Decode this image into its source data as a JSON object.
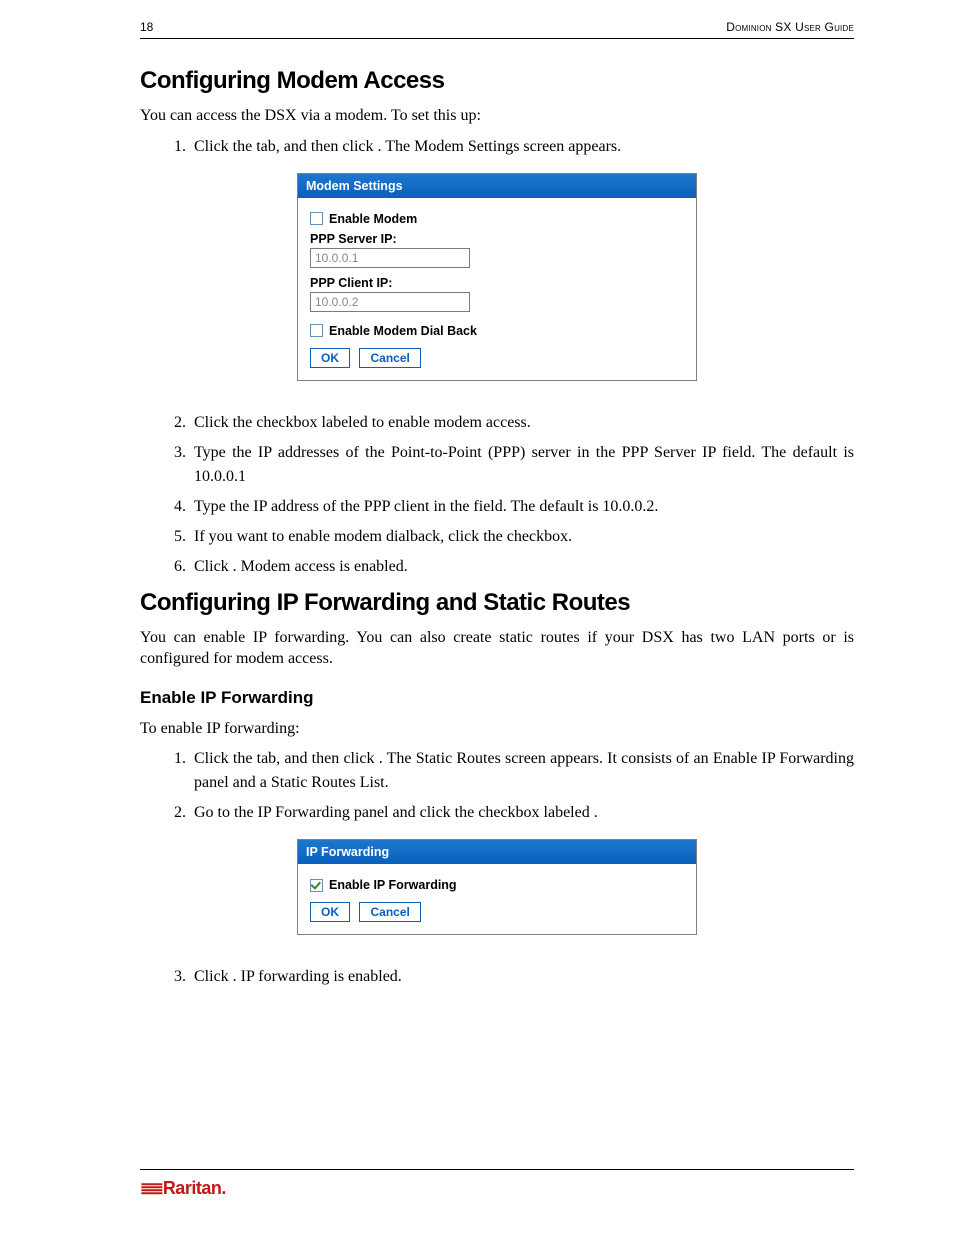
{
  "header": {
    "page_number": "18",
    "doc_title": "Dominion SX User Guide"
  },
  "section1": {
    "title": "Configuring Modem Access",
    "intro": "You can access the DSX via a modem. To set this up:",
    "steps_a": [
      "Click the         tab, and then click            . The Modem Settings screen appears."
    ],
    "steps_b": [
      "Click the checkbox labeled                           to enable modem access.",
      "Type the IP addresses of the Point-to-Point (PPP) server in the PPP Server IP field. The default is 10.0.0.1",
      "Type the IP address of the PPP client in the                        field. The default is 10.0.0.2.",
      "If you want to enable modem dialback, click the                                         checkbox.",
      "Click       . Modem access is enabled."
    ]
  },
  "modem_panel": {
    "title": "Modem Settings",
    "enable_modem_label": "Enable Modem",
    "ppp_server_label": "PPP Server IP:",
    "ppp_server_value": "10.0.0.1",
    "ppp_client_label": "PPP Client IP:",
    "ppp_client_value": "10.0.0.2",
    "enable_dialback_label": "Enable Modem Dial Back",
    "ok": "OK",
    "cancel": "Cancel"
  },
  "section2": {
    "title": "Configuring IP Forwarding and Static Routes",
    "intro": "You can enable IP forwarding. You can also create static routes if your DSX has two LAN ports or is configured for modem access.",
    "sub_title": "Enable IP Forwarding",
    "sub_intro": "To enable IP forwarding:",
    "steps_a": [
      "Click the          tab, and then click                  . The Static Routes screen appears. It consists of an Enable IP Forwarding panel and a Static Routes List.",
      "Go to the IP Forwarding panel and click the checkbox labeled                                     ."
    ],
    "steps_b": [
      "Click       . IP forwarding is enabled."
    ]
  },
  "ipfwd_panel": {
    "title": "IP Forwarding",
    "enable_label": "Enable IP Forwarding",
    "ok": "OK",
    "cancel": "Cancel"
  },
  "footer": {
    "brand": "Raritan",
    "dot": "."
  }
}
